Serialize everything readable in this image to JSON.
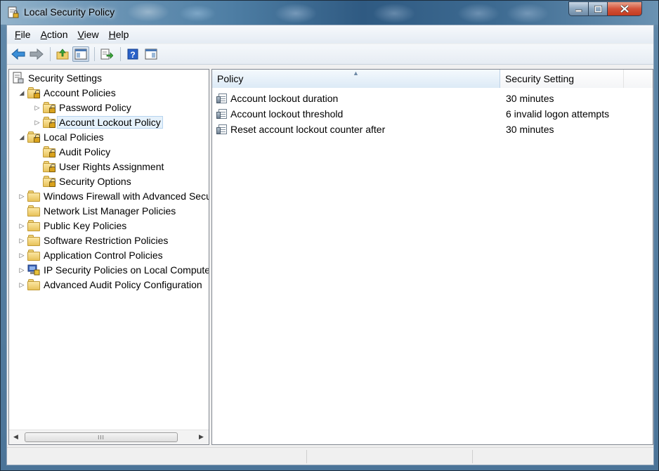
{
  "window": {
    "title": "Local Security Policy",
    "app_icon": "security-policy-icon",
    "controls": {
      "minimize_icon": "minimize-icon",
      "maximize_icon": "maximize-icon",
      "close_icon": "close-icon"
    }
  },
  "menu": {
    "items": [
      {
        "label": "File",
        "accel": "F",
        "rest": "ile"
      },
      {
        "label": "Action",
        "accel": "A",
        "rest": "ction"
      },
      {
        "label": "View",
        "accel": "V",
        "rest": "iew"
      },
      {
        "label": "Help",
        "accel": "H",
        "rest": "elp"
      }
    ]
  },
  "toolbar": {
    "buttons": [
      "back-arrow-icon",
      "forward-arrow-icon",
      "up-one-level-icon",
      "show-hide-console-tree-icon",
      "export-list-icon",
      "help-icon",
      "show-hide-action-pane-icon"
    ]
  },
  "tree": {
    "items": [
      {
        "label": "Security Settings",
        "level": 0,
        "arrow": "",
        "icon": "security-settings-icon"
      },
      {
        "label": "Account Policies",
        "level": 1,
        "arrow": "expanded",
        "icon": "locked-folder-icon"
      },
      {
        "label": "Password Policy",
        "level": 2,
        "arrow": "collapsed",
        "icon": "locked-folder-icon"
      },
      {
        "label": "Account Lockout Policy",
        "level": 2,
        "arrow": "collapsed",
        "icon": "locked-folder-icon",
        "selected": true
      },
      {
        "label": "Local Policies",
        "level": 1,
        "arrow": "expanded",
        "icon": "locked-folder-icon"
      },
      {
        "label": "Audit Policy",
        "level": 2,
        "arrow": "",
        "icon": "locked-folder-icon"
      },
      {
        "label": "User Rights Assignment",
        "level": 2,
        "arrow": "",
        "icon": "locked-folder-icon"
      },
      {
        "label": "Security Options",
        "level": 2,
        "arrow": "",
        "icon": "locked-folder-icon"
      },
      {
        "label": "Windows Firewall with Advanced Secu",
        "level": 1,
        "arrow": "collapsed",
        "icon": "folder-icon"
      },
      {
        "label": "Network List Manager Policies",
        "level": 1,
        "arrow": "",
        "icon": "folder-icon"
      },
      {
        "label": "Public Key Policies",
        "level": 1,
        "arrow": "collapsed",
        "icon": "folder-icon"
      },
      {
        "label": "Software Restriction Policies",
        "level": 1,
        "arrow": "collapsed",
        "icon": "folder-icon"
      },
      {
        "label": "Application Control Policies",
        "level": 1,
        "arrow": "collapsed",
        "icon": "folder-icon"
      },
      {
        "label": "IP Security Policies on Local Compute",
        "level": 1,
        "arrow": "collapsed",
        "icon": "ip-security-icon"
      },
      {
        "label": "Advanced Audit Policy Configuration",
        "level": 1,
        "arrow": "collapsed",
        "icon": "folder-icon"
      }
    ],
    "scrollbar_grip": "III"
  },
  "list": {
    "columns": [
      "Policy",
      "Security Setting"
    ],
    "rows": [
      {
        "policy": "Account lockout duration",
        "setting": "30 minutes"
      },
      {
        "policy": "Account lockout threshold",
        "setting": "6 invalid logon attempts"
      },
      {
        "policy": "Reset account lockout counter after",
        "setting": "30 minutes"
      }
    ]
  }
}
